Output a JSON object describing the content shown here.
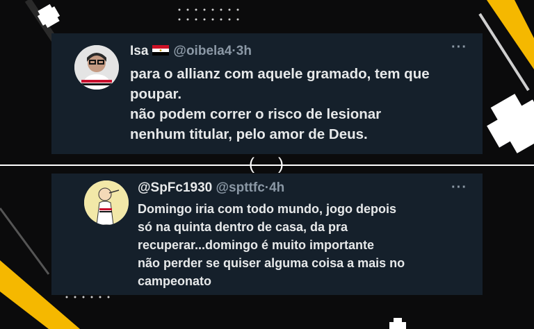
{
  "colors": {
    "background": "#0b0b0c",
    "card": "#15202b",
    "accent_yellow": "#f5b800",
    "text_primary": "#e7e9ea",
    "text_secondary": "#8b98a5"
  },
  "tweets": [
    {
      "display_name": "Isa",
      "flag": "egypt-flag",
      "handle": "@oibela4",
      "separator": "·",
      "time": "3h",
      "more": "···",
      "text": "para o allianz com aquele gramado, tem que\npoupar.\nnão podem correr o risco de lesionar\nnenhum titular, pelo amor de Deus."
    },
    {
      "display_name": "@SpFc1930",
      "handle": "@spttfc",
      "separator": "·",
      "time": "4h",
      "more": "···",
      "text": "Domingo iria com todo mundo, jogo depois\nsó na quinta dentro de casa, da pra\nrecuperar...domingo é muito importante\nnão perder se quiser alguma coisa a mais no\ncampeonato"
    }
  ],
  "divider": {
    "left": "(",
    "right": ")"
  }
}
